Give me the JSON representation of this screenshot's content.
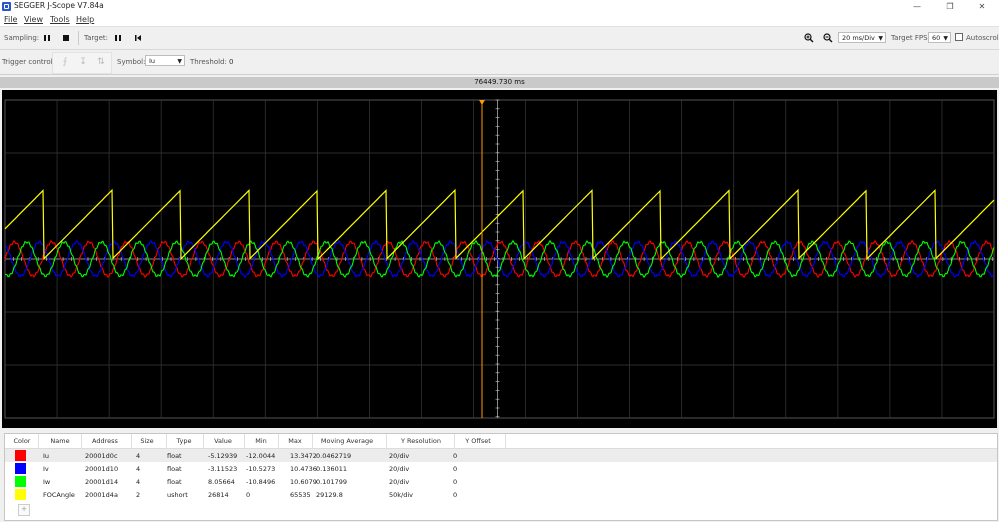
{
  "window": {
    "title": "SEGGER J-Scope V7.84a",
    "minimize": "—",
    "restore": "❐",
    "close": "✕"
  },
  "menu": [
    "File",
    "View",
    "Tools",
    "Help"
  ],
  "toolbar": {
    "sampling_label": "Sampling:",
    "target_label": "Target:",
    "time_div": "20 ms/Div",
    "fps_label": "Target FPS:",
    "fps_value": "60",
    "autoscroll_label": "Autoscroll"
  },
  "trigger": {
    "label": "Trigger control:",
    "symbol_label": "Symbol:",
    "symbol_value": "Iu",
    "threshold_label": "Threshold:",
    "threshold_value": "0"
  },
  "time_readout": "76449.730 ms",
  "colors": {
    "Iu": "#ff0000",
    "Iv": "#0000ff",
    "Iw": "#00ff00",
    "FOCAngle": "#ffff00",
    "cursor": "#ff9900"
  },
  "table": {
    "headers": [
      "Color",
      "Name",
      "Address",
      "Size",
      "Type",
      "Value",
      "Min",
      "Max",
      "Moving Average",
      "Y Resolution",
      "Y Offset"
    ],
    "rows": [
      {
        "color": "#ff0000",
        "name": "Iu",
        "address": "20001d0c",
        "size": "4",
        "type": "float",
        "value": "-5.12939",
        "min": "-12.0044",
        "max": "13.3472",
        "avg": "0.0462719",
        "yres": "20/div",
        "yoff": "0"
      },
      {
        "color": "#0000ff",
        "name": "Iv",
        "address": "20001d10",
        "size": "4",
        "type": "float",
        "value": "-3.11523",
        "min": "-10.5273",
        "max": "10.4736",
        "avg": "0.136011",
        "yres": "20/div",
        "yoff": "0"
      },
      {
        "color": "#00ff00",
        "name": "Iw",
        "address": "20001d14",
        "size": "4",
        "type": "float",
        "value": "8.05664",
        "min": "-10.8496",
        "max": "10.6079",
        "avg": "0.101799",
        "yres": "20/div",
        "yoff": "0"
      },
      {
        "color": "#ffff00",
        "name": "FOCAngle",
        "address": "20001d4a",
        "size": "2",
        "type": "ushort",
        "value": "26814",
        "min": "0",
        "max": "65535",
        "avg": "29129.8",
        "yres": "50k/div",
        "yoff": "0"
      }
    ],
    "add_label": "+"
  }
}
